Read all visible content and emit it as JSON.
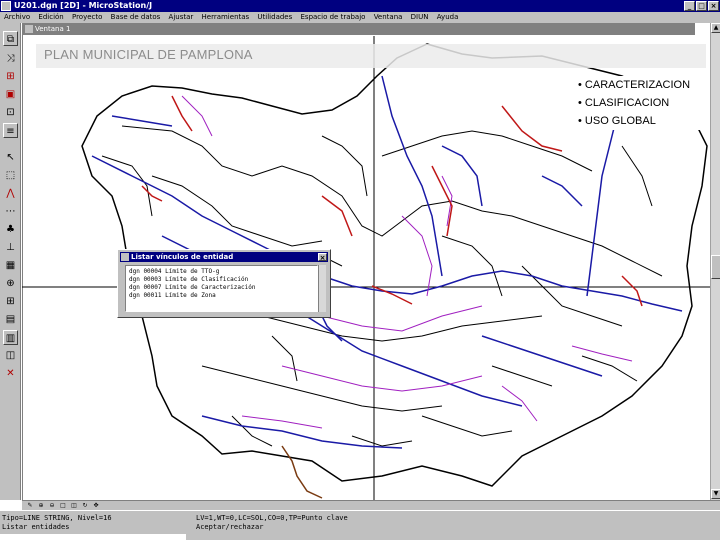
{
  "window": {
    "title": "U201.dgn [2D] - MicroStation/J",
    "minimize_glyph": "_",
    "maximize_glyph": "□",
    "close_glyph": "×"
  },
  "menu": [
    "Archivo",
    "Edición",
    "Proyecto",
    "Base de datos",
    "Ajustar",
    "Herramientas",
    "Utilidades",
    "Espacio de trabajo",
    "Ventana",
    "DIUN",
    "Ayuda"
  ],
  "view": {
    "title": "Ventana 1"
  },
  "slide": {
    "title": "PLAN MUNICIPAL DE PAMPLONA",
    "bullets": [
      "• CARACTERIZACION",
      "• CLASIFICACION",
      "• USO GLOBAL"
    ]
  },
  "dialog": {
    "title": "Listar vínculos de entidad",
    "close_glyph": "×",
    "rows": [
      "dgn 00004 Límite de TTO-g",
      "dgn 00003 Límite de Clasificación",
      "dgn 00007 Límite de Caracterización",
      "dgn 00011 Límite de Zona"
    ]
  },
  "status": {
    "element": "Tipo=LINE STRING, Nivel=16",
    "prompt": "Listar entidades",
    "level_info": "LV=1,WT=0,LC=SOL,CO=0,TP=Punto clave",
    "accept": "Aceptar/rechazar"
  },
  "tools": [
    "copy-element-icon",
    "move-element-icon",
    "scale-element-icon",
    "fence-icon",
    "modify-icon",
    "text-icon",
    "select-element-icon",
    "place-block-icon",
    "place-arc-icon",
    "measure-icon",
    "place-cell-icon",
    "dimension-icon",
    "pattern-icon",
    "zoom-icon",
    "grid-icon",
    "database-icon",
    "attach-link-icon",
    "review-icon",
    "delete-element-icon"
  ],
  "colors": {
    "titlebar": "#000080",
    "chrome": "#c0c0c0",
    "map_black": "#000000",
    "map_blue": "#1a1aa6",
    "map_purple": "#a020c0",
    "map_red": "#c01818",
    "map_brown": "#7a3b12",
    "slide_title": "#8c8c8c"
  }
}
